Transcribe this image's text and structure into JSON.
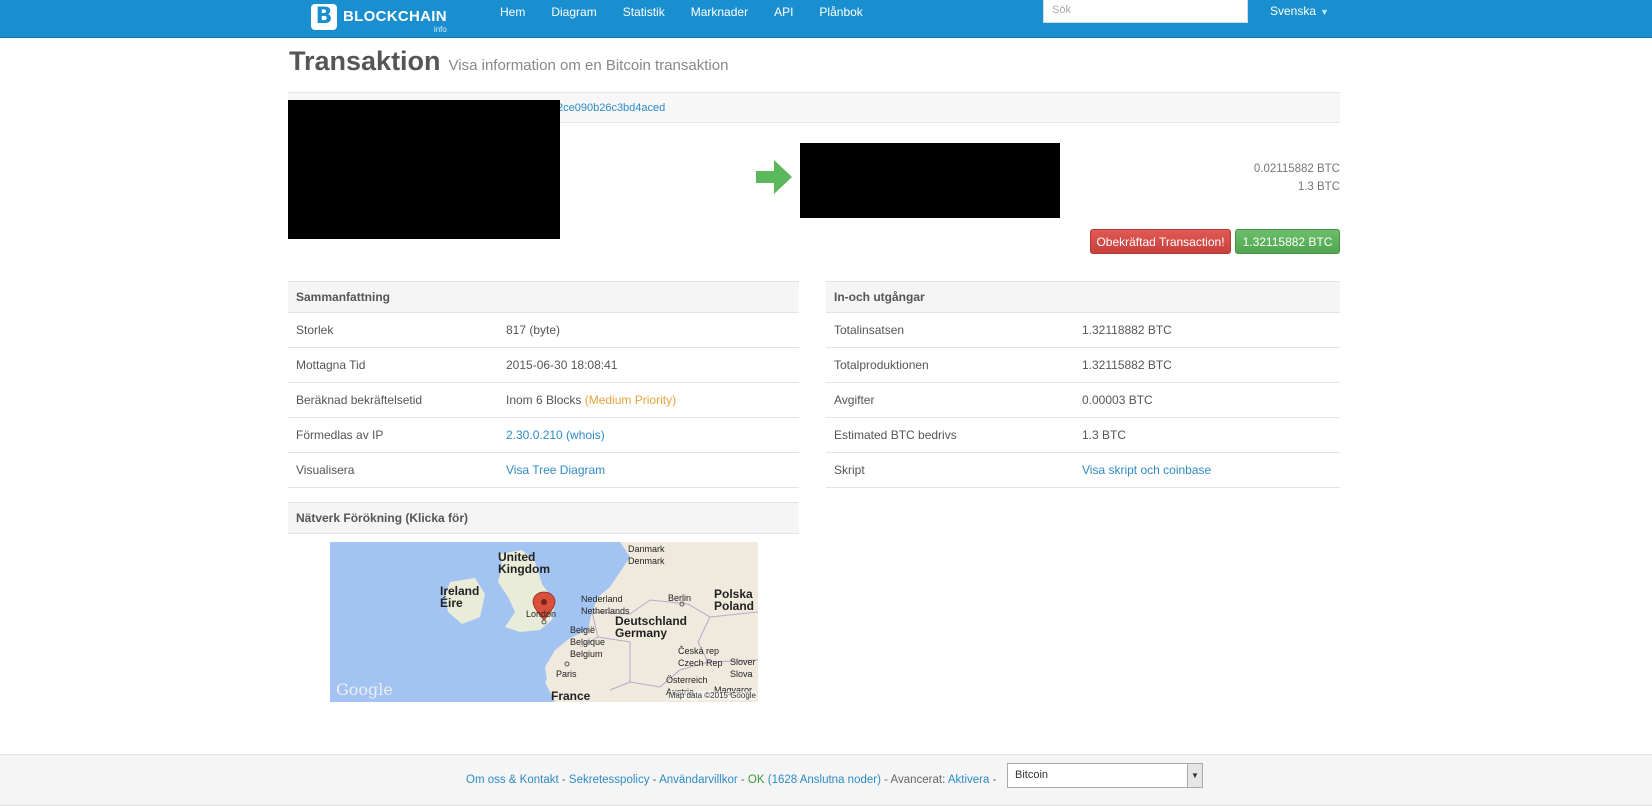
{
  "nav": {
    "brand_name": "BLOCKCHAIN",
    "brand_sub": "info",
    "brand_letter": "B",
    "links": [
      "Hem",
      "Diagram",
      "Statistik",
      "Marknader",
      "API",
      "Plånbok"
    ],
    "search_placeholder": "Sök",
    "language": "Svenska"
  },
  "header": {
    "title": "Transaktion",
    "subtitle": "Visa information om en Bitcoin transaktion"
  },
  "tx": {
    "hash_fragment": "2ce090b26c3bd4aced",
    "outputs": [
      "0.02115882 BTC",
      "1.3 BTC"
    ],
    "status_button": "Obekräftad Transaction!",
    "total_button": "1.32115882 BTC"
  },
  "summary": {
    "heading": "Sammanfattning",
    "rows": [
      {
        "label": "Storlek",
        "value": "817 (byte)"
      },
      {
        "label": "Mottagna Tid",
        "value": "2015-06-30 18:08:41"
      },
      {
        "label": "Beräknad bekräftelsetid",
        "value": "Inom 6 Blocks",
        "extra": "(Medium Priority)"
      },
      {
        "label": "Förmedlas av IP",
        "value": "2.30.0.210 (whois)"
      },
      {
        "label": "Visualisera",
        "value": "Visa Tree Diagram"
      }
    ]
  },
  "io": {
    "heading": "In-och utgångar",
    "rows": [
      {
        "label": "Totalinsatsen",
        "value": "1.32118882 BTC"
      },
      {
        "label": "Totalproduktionen",
        "value": "1.32115882 BTC"
      },
      {
        "label": "Avgifter",
        "value": "0.00003 BTC"
      },
      {
        "label": "Estimated BTC bedrivs",
        "value": "1.3 BTC"
      },
      {
        "label": "Skript",
        "value": "Visa skript och coinbase"
      }
    ]
  },
  "network": {
    "heading": "Nätverk Förökning (Klicka för)",
    "map_labels": {
      "uk": "United\nKingdom",
      "ireland": "Ireland\nÉire",
      "london": "London",
      "denmark": "Danmark\nDenmark",
      "netherlands": "Nederland\nNetherlands",
      "berlin": "Berlin",
      "poland": "Polska\nPoland",
      "germany": "Deutschland\nGermany",
      "belgium": "België\nBelgique\nBelgium",
      "czech": "Česká rep\nCzech Rep",
      "slovakia": "Slover\nSlova",
      "paris": "Paris",
      "austria": "Österreich\nAustria",
      "france": "France",
      "magyar": "Magyaror"
    },
    "google": "Google",
    "map_data": "Map data ©2015 Google"
  },
  "footer": {
    "links": [
      "Om oss & Kontakt",
      "Sekretesspolicy",
      "Användarvillkor"
    ],
    "status": "OK",
    "nodes": "(1628 Anslutna noder)",
    "advanced_label": "Avancerat:",
    "activate": "Aktivera",
    "currency": "Bitcoin"
  },
  "colors": {
    "navbar": "#1a8fd0",
    "link": "#2e8bc8",
    "danger": "#d9534f",
    "success": "#5cb85c"
  }
}
